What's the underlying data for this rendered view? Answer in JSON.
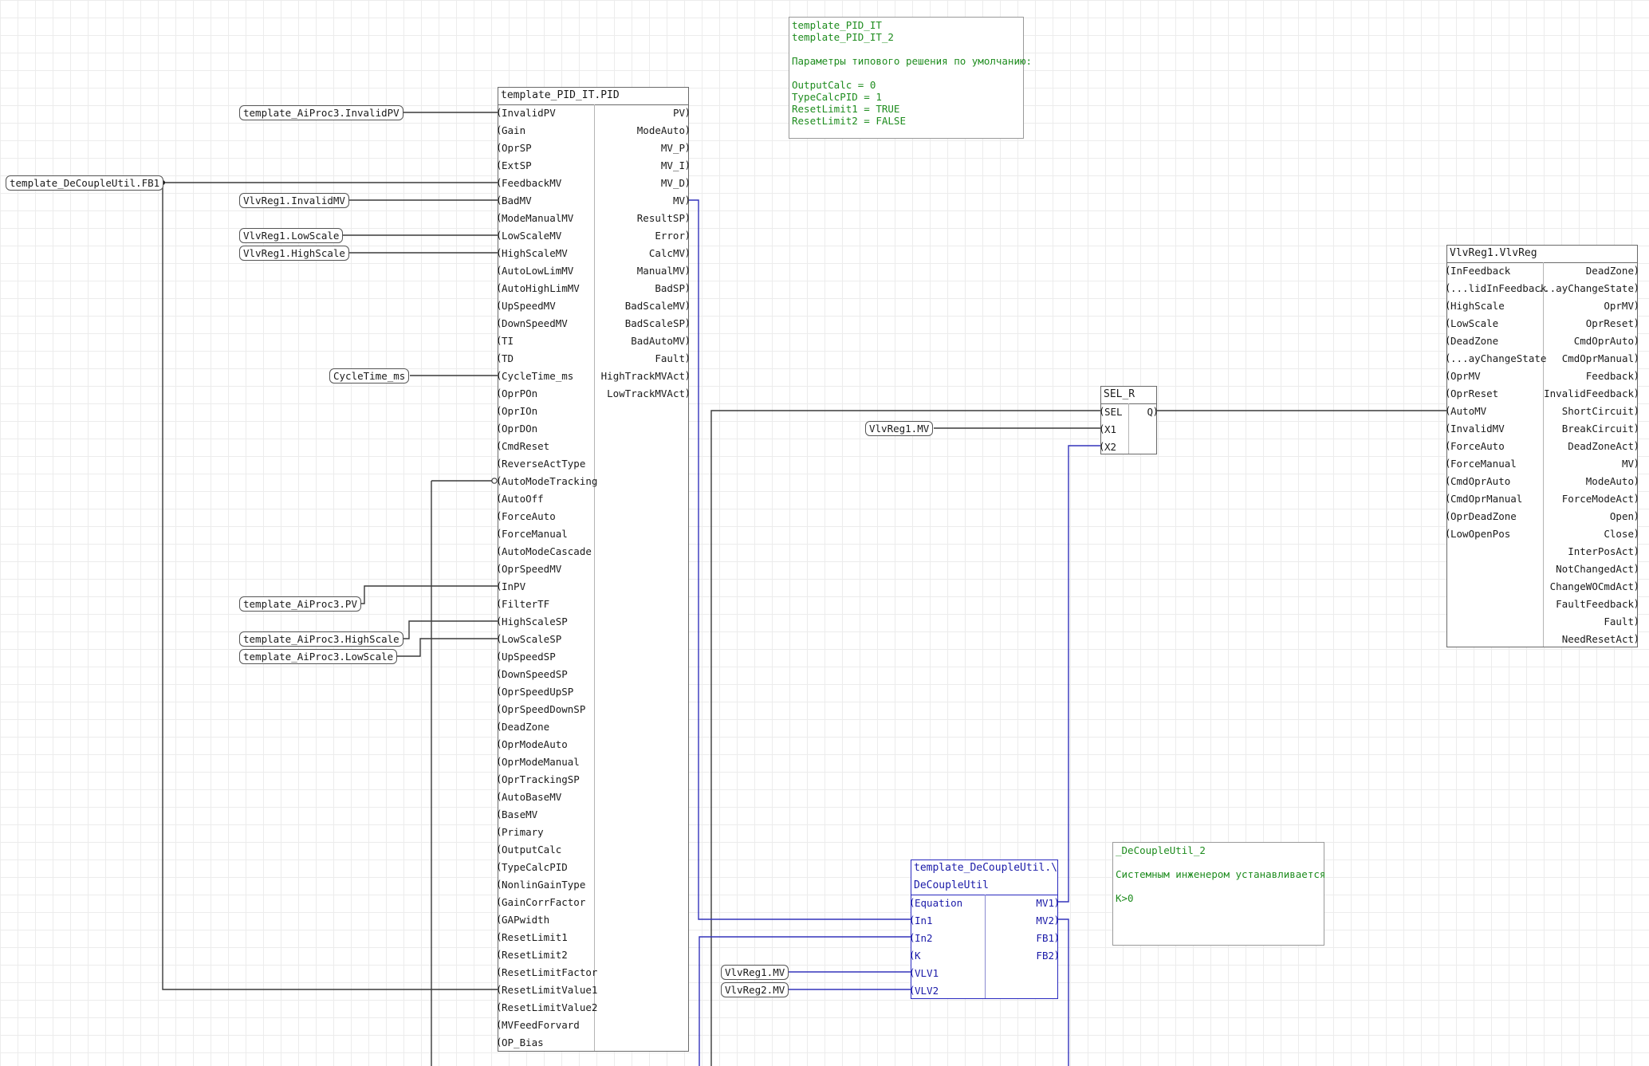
{
  "notes": {
    "top": {
      "lines": [
        "template_PID_IT",
        "template_PID_IT_2",
        "",
        "Параметры типового решения по умолчанию:",
        "",
        "OutputCalc = 0",
        "TypeCalcPID = 1",
        "ResetLimit1 = TRUE",
        "ResetLimit2 = FALSE"
      ]
    },
    "decouple": {
      "lines": [
        "_DeCoupleUtil_2",
        "",
        "Системным инженером устанавливается",
        "",
        "K>0"
      ]
    }
  },
  "pid": {
    "title": "template_PID_IT.PID",
    "inputs": [
      "InvalidPV",
      "Gain",
      "OprSP",
      "ExtSP",
      "FeedbackMV",
      "BadMV",
      "ModeManualMV",
      "LowScaleMV",
      "HighScaleMV",
      "AutoLowLimMV",
      "AutoHighLimMV",
      "UpSpeedMV",
      "DownSpeedMV",
      "TI",
      "TD",
      "CycleTime_ms",
      "OprPOn",
      "OprIOn",
      "OprDOn",
      "CmdReset",
      "ReverseActType",
      "AutoModeTracking",
      "AutoOff",
      "ForceAuto",
      "ForceManual",
      "AutoModeCascade",
      "OprSpeedMV",
      "InPV",
      "FilterTF",
      "HighScaleSP",
      "LowScaleSP",
      "UpSpeedSP",
      "DownSpeedSP",
      "OprSpeedUpSP",
      "OprSpeedDownSP",
      "DeadZone",
      "OprModeAuto",
      "OprModeManual",
      "OprTrackingSP",
      "AutoBaseMV",
      "BaseMV",
      "Primary",
      "OutputCalc",
      "TypeCalcPID",
      "NonlinGainType",
      "GainCorrFactor",
      "GAPwidth",
      "ResetLimit1",
      "ResetLimit2",
      "ResetLimitFactor",
      "ResetLimitValue1",
      "ResetLimitValue2",
      "MVFeedForvard",
      "OP_Bias"
    ],
    "outputs": [
      "PV",
      "ModeAuto",
      "MV_P",
      "MV_I",
      "MV_D",
      "MV",
      "ResultSP",
      "Error",
      "CalcMV",
      "ManualMV",
      "BadSP",
      "BadScaleMV",
      "BadScaleSP",
      "BadAutoMV",
      "Fault",
      "HighTrackMVAct",
      "LowTrackMVAct"
    ]
  },
  "selr": {
    "title": "SEL_R",
    "inputs": [
      "SEL",
      "X1",
      "X2"
    ],
    "outputs": [
      "Q"
    ]
  },
  "vlvreg": {
    "title": "VlvReg1.VlvReg",
    "inputs": [
      "InFeedback",
      "...lidInFeedback",
      "HighScale",
      "LowScale",
      "DeadZone",
      "...ayChangeState",
      "OprMV",
      "OprReset",
      "AutoMV",
      "InvalidMV",
      "ForceAuto",
      "ForceManual",
      "CmdOprAuto",
      "CmdOprManual",
      "OprDeadZone",
      "LowOpenPos"
    ],
    "outputs": [
      "DeadZone",
      "...ayChangeState",
      "OprMV",
      "OprReset",
      "CmdOprAuto",
      "CmdOprManual",
      "Feedback",
      "InvalidFeedback",
      "ShortCircuit",
      "BreakCircuit",
      "DeadZoneAct",
      "MV",
      "ModeAuto",
      "ForceModeAct",
      "Open",
      "Close",
      "InterPosAct",
      "NotChangedAct",
      "ChangeWOCmdAct",
      "FaultFeedback",
      "Fault",
      "NeedResetAct"
    ]
  },
  "decouple": {
    "title_lines": [
      "template_DeCoupleUtil.\\",
      "DeCoupleUtil"
    ],
    "inputs": [
      "Equation",
      "In1",
      "In2",
      "K",
      "VLV1",
      "VLV2"
    ],
    "outputs": [
      "MV1",
      "MV2",
      "FB1",
      "FB2"
    ]
  },
  "tags": {
    "fb1": "template_DeCoupleUtil.FB1",
    "invalid_pv": "template_AiProc3.InvalidPV",
    "invalid_mv": "VlvReg1.InvalidMV",
    "low_scale": "VlvReg1.LowScale",
    "high_scale": "VlvReg1.HighScale",
    "cycle_time": "CycleTime_ms",
    "aiproc_pv": "template_AiProc3.PV",
    "aiproc_high": "template_AiProc3.HighScale",
    "aiproc_low": "template_AiProc3.LowScale",
    "vlvreg1_mv_sel": "VlvReg1.MV",
    "vlvreg1_mv": "VlvReg1.MV",
    "vlvreg2_mv": "VlvReg2.MV"
  },
  "colors": {
    "wire_black": "#3a3a3a",
    "wire_blue": "#3333bb",
    "note_text": "#1e8c1e",
    "grid": "#ececec"
  }
}
